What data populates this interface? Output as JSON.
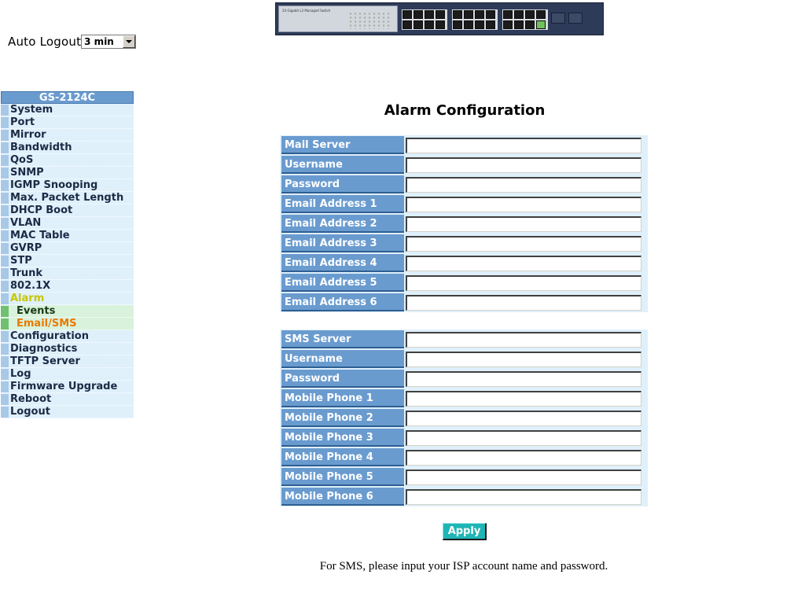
{
  "banner": {
    "icon": "switch-front-panel-image",
    "model_text": "24-Gigabit L2 Managed Switch"
  },
  "auto_logout": {
    "label": "Auto Logout",
    "selected": "3 min"
  },
  "sidebar": {
    "header": "GS-2124C",
    "items": [
      {
        "label": "System"
      },
      {
        "label": "Port"
      },
      {
        "label": "Mirror"
      },
      {
        "label": "Bandwidth"
      },
      {
        "label": "QoS"
      },
      {
        "label": "SNMP"
      },
      {
        "label": "IGMP Snooping"
      },
      {
        "label": "Max. Packet Length"
      },
      {
        "label": "DHCP Boot"
      },
      {
        "label": "VLAN"
      },
      {
        "label": "MAC Table"
      },
      {
        "label": "GVRP"
      },
      {
        "label": "STP"
      },
      {
        "label": "Trunk"
      },
      {
        "label": "802.1X"
      },
      {
        "label": "Alarm"
      },
      {
        "label": "Events"
      },
      {
        "label": "Email/SMS"
      },
      {
        "label": "Configuration"
      },
      {
        "label": "Diagnostics"
      },
      {
        "label": "TFTP Server"
      },
      {
        "label": "Log"
      },
      {
        "label": "Firmware Upgrade"
      },
      {
        "label": "Reboot"
      },
      {
        "label": "Logout"
      }
    ],
    "colors": {
      "header": "#6a9bcf",
      "active": "#c7c700",
      "current_sub": "#e87a00"
    }
  },
  "main": {
    "title": "Alarm Configuration",
    "mail_rows": [
      {
        "label": "Mail Server",
        "value": ""
      },
      {
        "label": "Username",
        "value": ""
      },
      {
        "label": "Password",
        "value": ""
      },
      {
        "label": "Email Address 1",
        "value": ""
      },
      {
        "label": "Email Address 2",
        "value": ""
      },
      {
        "label": "Email Address 3",
        "value": ""
      },
      {
        "label": "Email Address 4",
        "value": ""
      },
      {
        "label": "Email Address 5",
        "value": ""
      },
      {
        "label": "Email Address 6",
        "value": ""
      }
    ],
    "sms_rows": [
      {
        "label": "SMS Server",
        "value": ""
      },
      {
        "label": "Username",
        "value": ""
      },
      {
        "label": "Password",
        "value": ""
      },
      {
        "label": "Mobile Phone 1",
        "value": ""
      },
      {
        "label": "Mobile Phone 2",
        "value": ""
      },
      {
        "label": "Mobile Phone 3",
        "value": ""
      },
      {
        "label": "Mobile Phone 4",
        "value": ""
      },
      {
        "label": "Mobile Phone 5",
        "value": ""
      },
      {
        "label": "Mobile Phone 6",
        "value": ""
      }
    ],
    "apply_label": "Apply",
    "note": "For SMS, please input your ISP account name and password."
  }
}
